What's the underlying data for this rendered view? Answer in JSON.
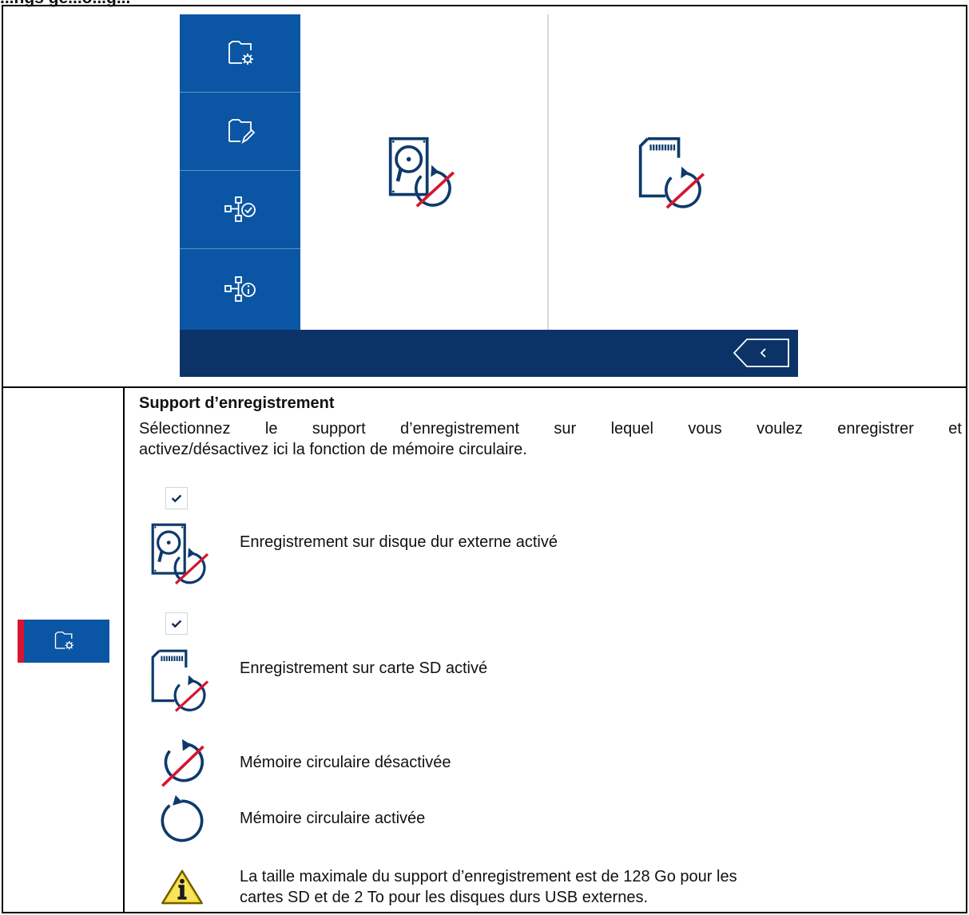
{
  "page_heading": "...ngs gé...o...g...",
  "screen": {
    "sidebar": [
      {
        "icon": "folder-settings-icon"
      },
      {
        "icon": "folder-edit-icon"
      },
      {
        "icon": "network-check-icon"
      },
      {
        "icon": "network-info-icon"
      }
    ],
    "panels": [
      {
        "icon": "hard-disk-ring-off-icon"
      },
      {
        "icon": "sd-card-ring-off-icon"
      }
    ],
    "back_icon": "chevron-left-icon"
  },
  "colors": {
    "primary": "#0b56a4",
    "dark": "#0b3368",
    "accent": "#d7152f",
    "icon": "#0d3a6b"
  },
  "section": {
    "thumb_icon": "folder-settings-icon",
    "title": "Support d’enregistrement",
    "desc_line1": "Sélectionnez le support d’enregistrement sur lequel vous voulez enregistrer et",
    "desc_line2": "activez/désactivez ici la fonction de mémoire circulaire.",
    "items": [
      {
        "label": "Enregistrement sur disque dur externe activé"
      },
      {
        "label": "Enregistrement sur carte SD activé"
      },
      {
        "label": "Mémoire circulaire désactivée"
      },
      {
        "label": "Mémoire circulaire activée"
      }
    ],
    "note_line1": "La taille maximale du support d’enregistrement est de 128 Go pour les",
    "note_line2": "cartes SD et de 2 To pour les disques durs USB externes."
  }
}
